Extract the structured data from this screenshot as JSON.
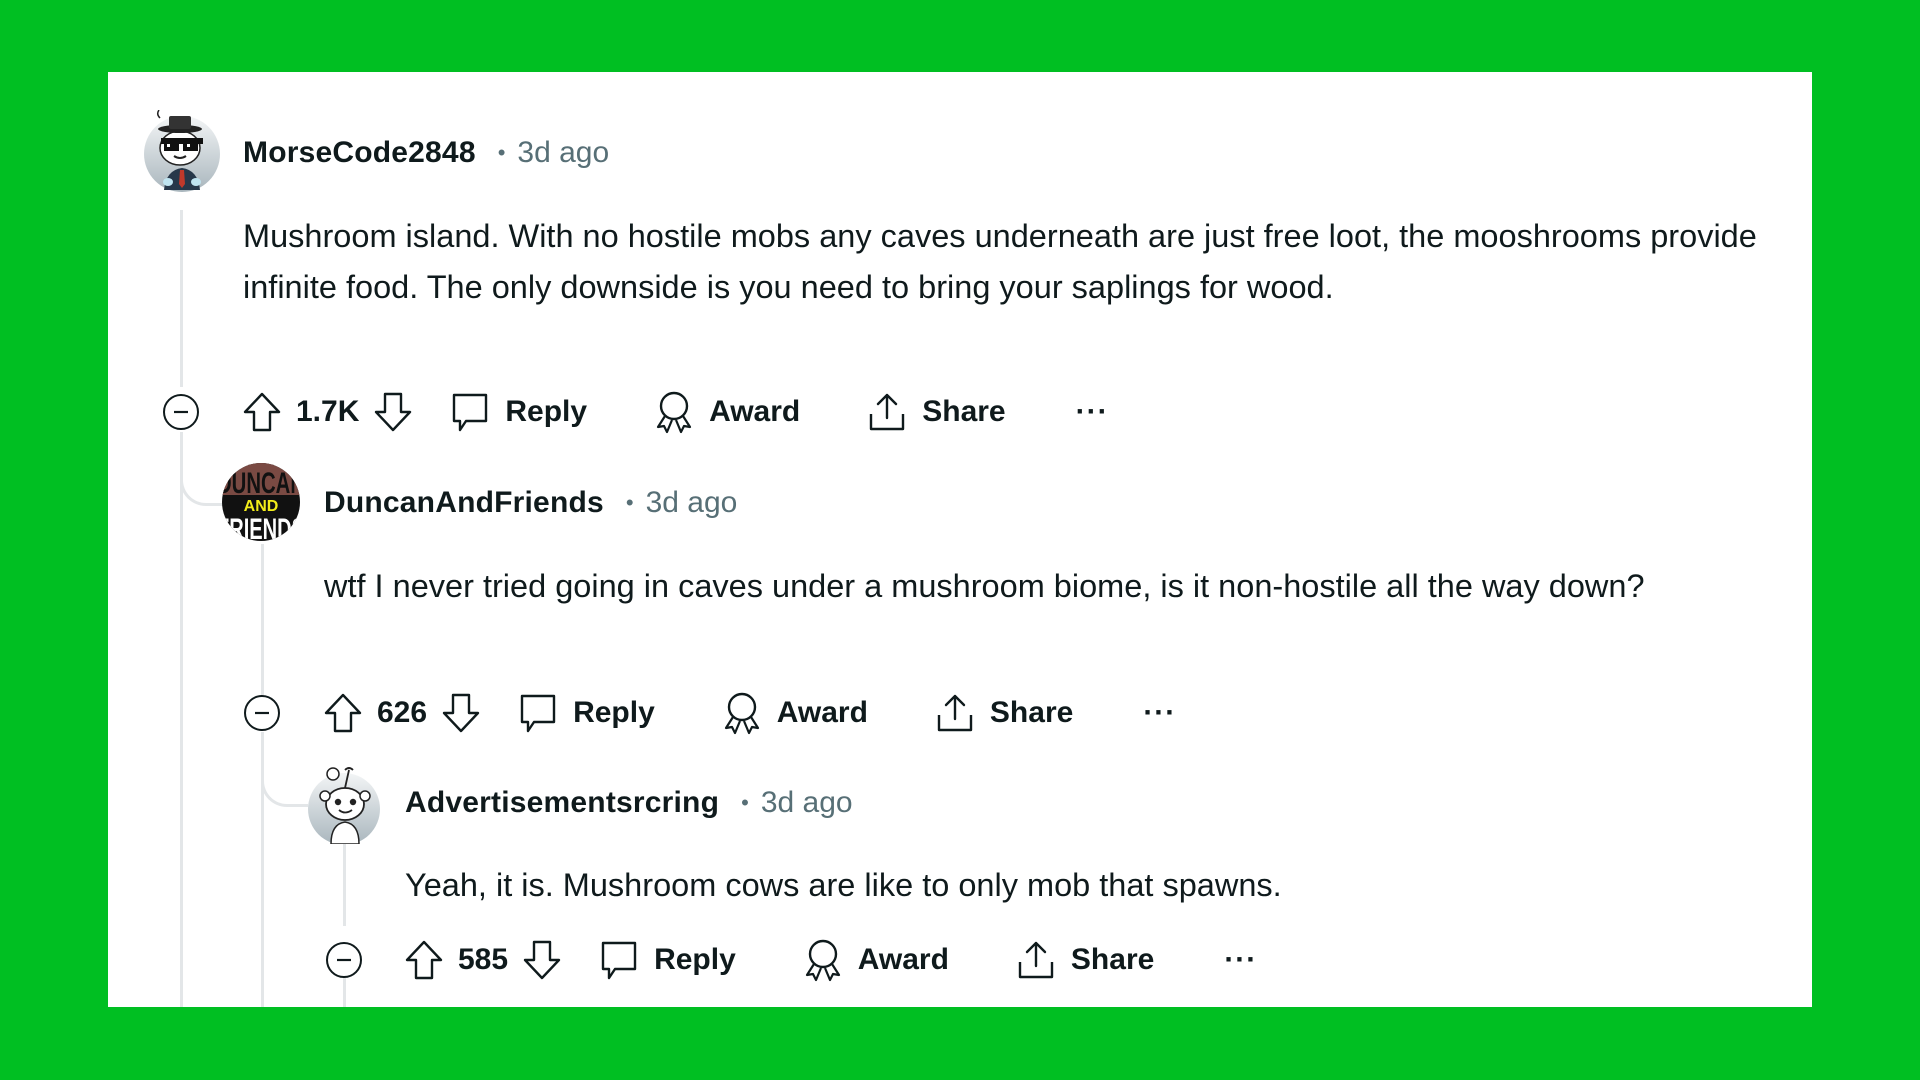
{
  "colors": {
    "background": "#00BF22",
    "card": "#ffffff",
    "meta": "#576f76",
    "text": "#0f1a1c",
    "thread": "#e3e6e8"
  },
  "comments": [
    {
      "username": "MorseCode2848",
      "separator": "•",
      "time": "3d ago",
      "avatar_icon": "snoo-avatar-hat-sunglasses",
      "body": "Mushroom island. With no hostile mobs any caves underneath are just free loot, the mooshrooms provide infinite food. The only downside is you need to bring your saplings for wood.",
      "votes": "1.7K",
      "reply_label": "Reply",
      "award_label": "Award",
      "share_label": "Share",
      "more_label": "···"
    },
    {
      "username": "DuncanAndFriends",
      "separator": "•",
      "time": "3d ago",
      "avatar_icon": "duncan-and-friends-logo-avatar",
      "avatar_text_top": "DUNCAN",
      "avatar_text_mid": "AND",
      "avatar_text_bot": "FRIENDS",
      "body": "wtf I never tried going in caves under a mushroom biome, is it non-hostile all the way down?",
      "votes": "626",
      "reply_label": "Reply",
      "award_label": "Award",
      "share_label": "Share",
      "more_label": "···"
    },
    {
      "username": "Advertisementsrcring",
      "separator": "•",
      "time": "3d ago",
      "avatar_icon": "snoo-default-avatar",
      "body": "Yeah, it is. Mushroom cows are like to only mob that spawns.",
      "votes": "585",
      "reply_label": "Reply",
      "award_label": "Award",
      "share_label": "Share",
      "more_label": "···"
    }
  ]
}
